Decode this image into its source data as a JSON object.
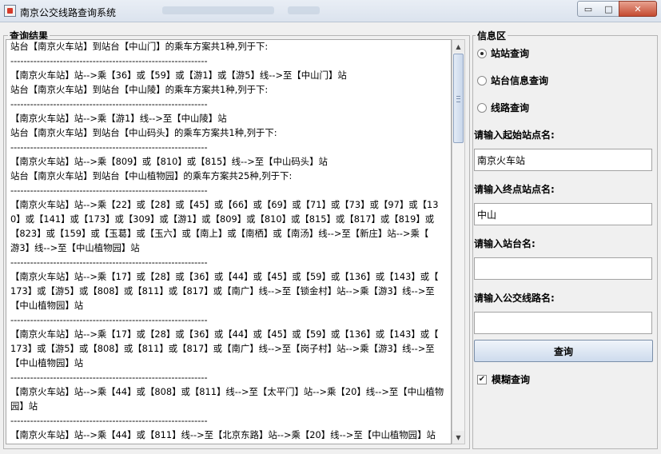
{
  "window": {
    "title": "南京公交线路查询系统",
    "minimize_glyph": "▭",
    "maximize_glyph": "□",
    "close_glyph": "✕"
  },
  "results": {
    "title": "查询结果",
    "lines": [
      "站台【南京火车站】到站台【中山门】的乘车方案共1种,列于下:",
      "------------------------------------------------------------",
      "【南京火车站】站-->乘【36】或【59】或【游1】或【游5】线-->至【中山门】站",
      "站台【南京火车站】到站台【中山陵】的乘车方案共1种,列于下:",
      "------------------------------------------------------------",
      "【南京火车站】站-->乘【游1】线-->至【中山陵】站",
      "站台【南京火车站】到站台【中山码头】的乘车方案共1种,列于下:",
      "------------------------------------------------------------",
      "【南京火车站】站-->乘【809】或【810】或【815】线-->至【中山码头】站",
      "站台【南京火车站】到站台【中山植物园】的乘车方案共25种,列于下:",
      "------------------------------------------------------------",
      "【南京火车站】站-->乘【22】或【28】或【45】或【66】或【69】或【71】或【73】或【97】或【13",
      "0】或【141】或【173】或【309】或【游1】或【809】或【810】或【815】或【817】或【819】或",
      "【823】或【159】或【玉葛】或【玉六】或【南上】或【南栖】或【南汤】线-->至【新庄】站-->乘【",
      "游3】线-->至【中山植物园】站",
      "------------------------------------------------------------",
      "【南京火车站】站-->乘【17】或【28】或【36】或【44】或【45】或【59】或【136】或【143】或【",
      "173】或【游5】或【808】或【811】或【817】或【南广】线-->至【锁金村】站-->乘【游3】线-->至",
      "【中山植物园】站",
      "------------------------------------------------------------",
      "【南京火车站】站-->乘【17】或【28】或【36】或【44】或【45】或【59】或【136】或【143】或【",
      "173】或【游5】或【808】或【811】或【817】或【南广】线-->至【岗子村】站-->乘【游3】线-->至",
      "【中山植物园】站",
      "------------------------------------------------------------",
      "【南京火车站】站-->乘【44】或【808】或【811】线-->至【太平门】站-->乘【20】线-->至【中山植物",
      "园】站",
      "------------------------------------------------------------",
      "【南京火车站】站-->乘【44】或【811】线-->至【北京东路】站-->乘【20】线-->至【中山植物园】站"
    ]
  },
  "info": {
    "title": "信息区",
    "radio_station_query": "站站查询",
    "radio_station_info": "站台信息查询",
    "radio_line_query": "线路查询",
    "selected_radio": "站站查询",
    "start_label": "请输入起始站点名:",
    "start_value": "南京火车站",
    "end_label": "请输入终点站点名:",
    "end_value": "中山",
    "station_label": "请输入站台名:",
    "station_value": "",
    "line_label": "请输入公交线路名:",
    "line_value": "",
    "query_button": "查询",
    "fuzzy_label": "模糊查询",
    "fuzzy_checked": true,
    "check_glyph": "✔"
  }
}
